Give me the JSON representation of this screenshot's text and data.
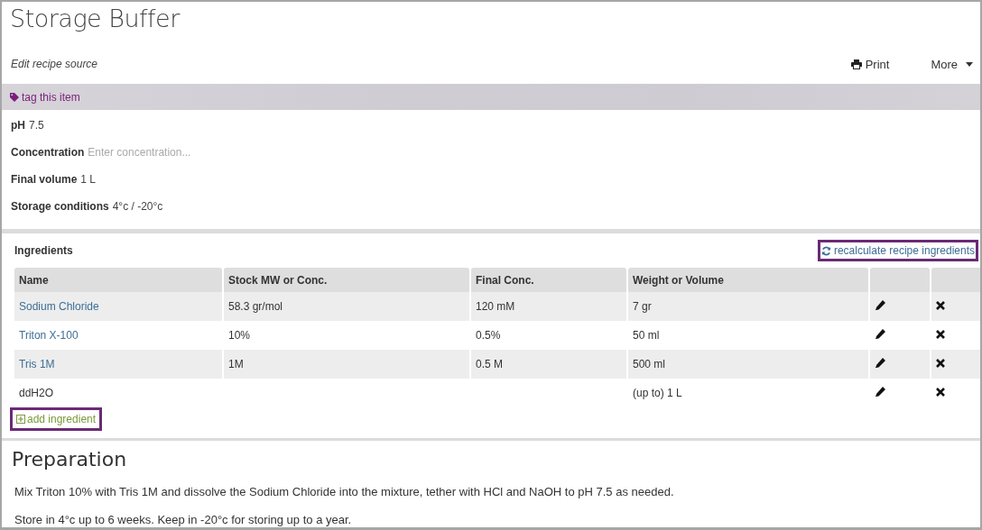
{
  "title": "Storage Buffer",
  "source_link": "Edit recipe source",
  "actions": [
    {
      "kind": "print",
      "label": "Print"
    },
    {
      "kind": "menu",
      "label": "More"
    }
  ],
  "tag_link": "tag this item",
  "properties": [
    {
      "label": "pH",
      "value": "7.5"
    },
    {
      "label": "Concentration",
      "placeholder": "Enter concentration..."
    },
    {
      "label": "Final volume",
      "value": "1 L"
    },
    {
      "label": "Storage conditions",
      "value": "4°c / -20°c"
    }
  ],
  "ingredients": {
    "title": "Ingredients",
    "recalculate": {
      "label": "recalculate recipe ingredients",
      "highlighted": true
    },
    "columns": [
      "Name",
      "Stock MW or Conc.",
      "Final Conc.",
      "Weight or Volume"
    ],
    "rows": [
      {
        "name": "Sodium Chloride",
        "linked": true,
        "stock": "58.3 gr/mol",
        "final": "120 mM",
        "amount": "7 gr"
      },
      {
        "name": "Triton X-100",
        "linked": true,
        "stock": "10%",
        "final": "0.5%",
        "amount": "50 ml"
      },
      {
        "name": "Tris 1M",
        "linked": true,
        "stock": "1M",
        "final": "0.5 M",
        "amount": "500 ml"
      },
      {
        "name": "ddH2O",
        "linked": false,
        "amount": "(up to) 1 L"
      }
    ],
    "add": {
      "label": "add ingredient",
      "highlighted": true
    }
  },
  "preparation": {
    "title": "Preparation",
    "paragraphs": [
      "Mix Triton 10% with Tris 1M and dissolve the Sodium Chloride into the mixture, tether with HCl and NaOH to pH 7.5 as needed.",
      "Store in 4°c up to 6 weeks. Keep in -20°c for storing up to a year."
    ]
  }
}
